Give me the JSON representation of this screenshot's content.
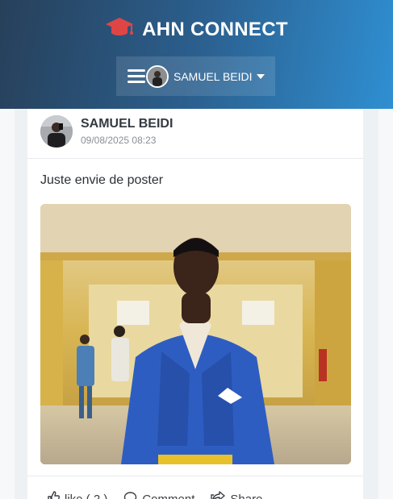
{
  "app": {
    "title": "AHN CONNECT",
    "logo_icon": "graduation-cap-icon",
    "brand_color": "#e04040"
  },
  "nav": {
    "username": "SAMUEL BEIDI"
  },
  "post": {
    "author": "SAMUEL BEIDI",
    "timestamp": "09/08/2025 08:23",
    "text": "Juste envie de poster",
    "actions": {
      "like_label": "like ( 2 )",
      "comment_label": "Comment",
      "share_label": "Share"
    }
  }
}
